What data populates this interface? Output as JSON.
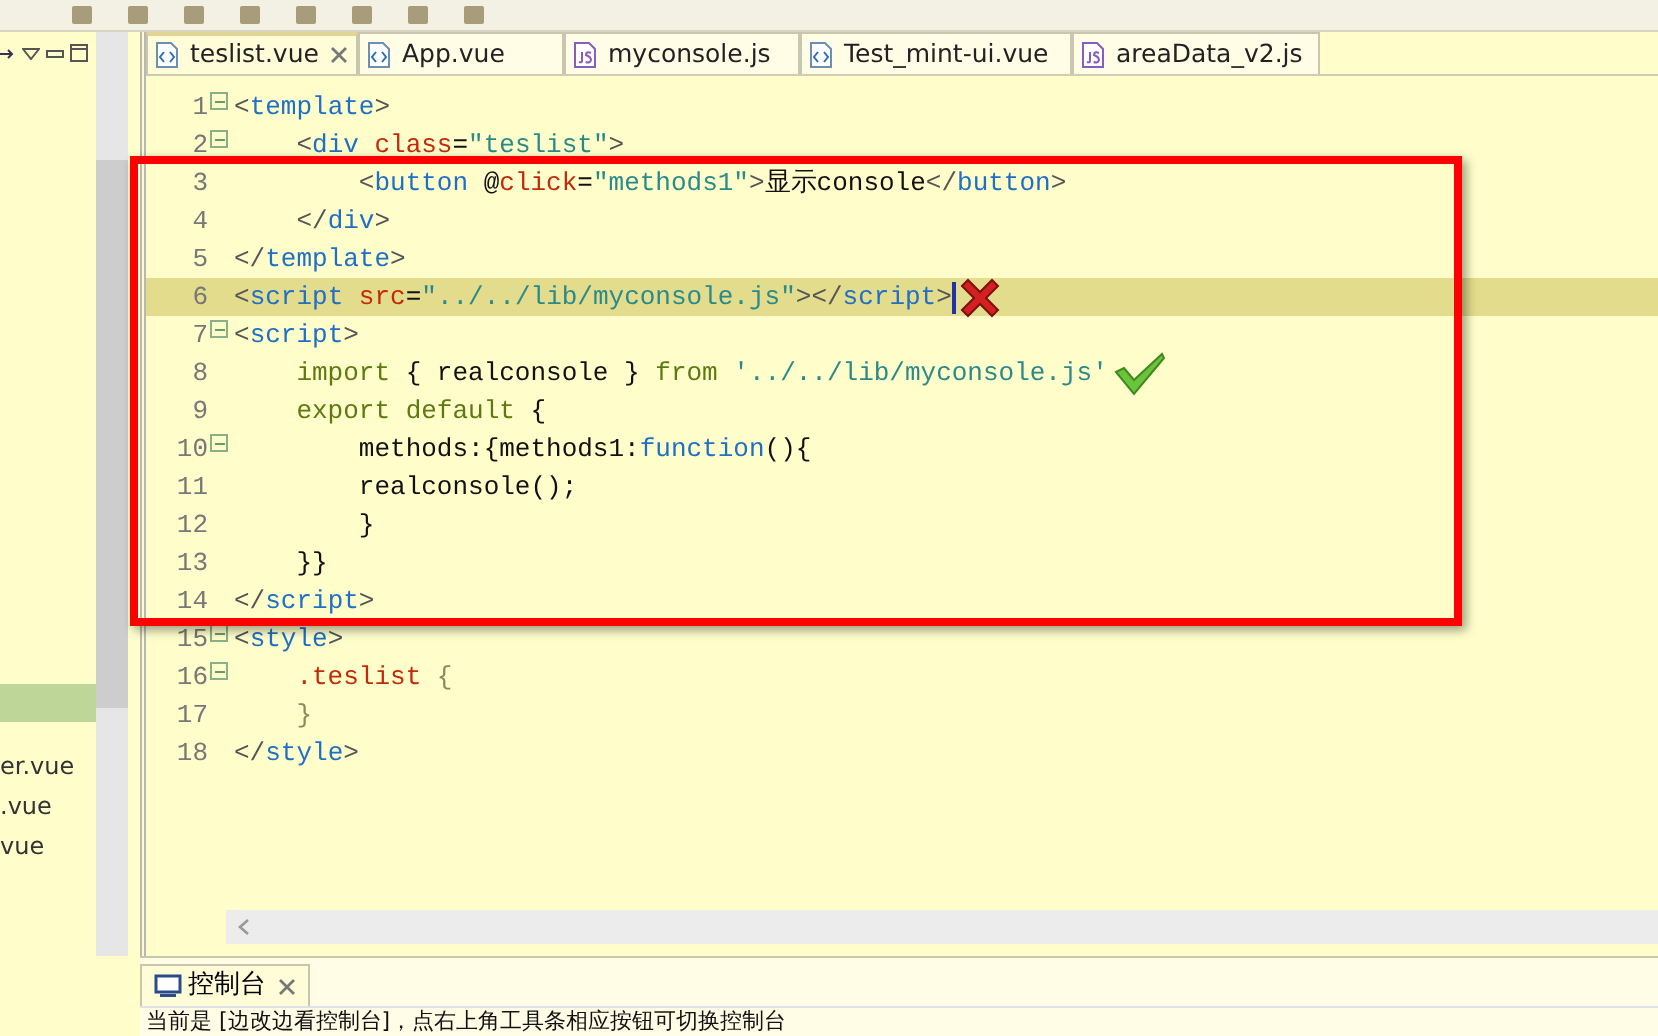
{
  "sidebar": {
    "items": [
      {
        "label": "er.vue"
      },
      {
        "label": ".vue"
      },
      {
        "label": "vue"
      }
    ]
  },
  "tabs": [
    {
      "label": "teslist.vue",
      "kind": "vue",
      "selected": true
    },
    {
      "label": "App.vue",
      "kind": "vue",
      "selected": false
    },
    {
      "label": "myconsole.js",
      "kind": "js",
      "selected": false
    },
    {
      "label": "Test_mint-ui.vue",
      "kind": "vue",
      "selected": false
    },
    {
      "label": "areaData_v2.js",
      "kind": "js",
      "selected": false
    }
  ],
  "editor": {
    "lines": [
      {
        "number": "1",
        "foldable": true,
        "highlighted": false,
        "tokens": [
          {
            "kind": "punct",
            "text": "<"
          },
          {
            "kind": "tag",
            "text": "template"
          },
          {
            "kind": "punct",
            "text": ">"
          }
        ]
      },
      {
        "number": "2",
        "foldable": true,
        "highlighted": false,
        "tokens": [
          {
            "kind": "punct",
            "text": "    <"
          },
          {
            "kind": "tag",
            "text": "div"
          },
          {
            "kind": "attr",
            "text": " class"
          },
          {
            "kind": "text",
            "text": "="
          },
          {
            "kind": "str",
            "text": "\"teslist\""
          },
          {
            "kind": "punct",
            "text": ">"
          }
        ]
      },
      {
        "number": "3",
        "foldable": false,
        "highlighted": false,
        "tokens": [
          {
            "kind": "punct",
            "text": "        <"
          },
          {
            "kind": "tag",
            "text": "button"
          },
          {
            "kind": "text",
            "text": " @"
          },
          {
            "kind": "attr",
            "text": "click"
          },
          {
            "kind": "text",
            "text": "="
          },
          {
            "kind": "str",
            "text": "\"methods1\""
          },
          {
            "kind": "punct",
            "text": ">"
          },
          {
            "kind": "text",
            "text": "显示console"
          },
          {
            "kind": "punct",
            "text": "</"
          },
          {
            "kind": "tag",
            "text": "button"
          },
          {
            "kind": "punct",
            "text": ">"
          }
        ]
      },
      {
        "number": "4",
        "foldable": false,
        "highlighted": false,
        "tokens": [
          {
            "kind": "punct",
            "text": "    </"
          },
          {
            "kind": "tag",
            "text": "div"
          },
          {
            "kind": "punct",
            "text": ">"
          }
        ]
      },
      {
        "number": "5",
        "foldable": false,
        "highlighted": false,
        "tokens": [
          {
            "kind": "punct",
            "text": "</"
          },
          {
            "kind": "tag",
            "text": "template"
          },
          {
            "kind": "punct",
            "text": ">"
          }
        ]
      },
      {
        "number": "6",
        "foldable": false,
        "highlighted": true,
        "cursor": true,
        "kind": "error",
        "tokens": [
          {
            "kind": "punct",
            "text": "<"
          },
          {
            "kind": "tag",
            "text": "script"
          },
          {
            "kind": "attr",
            "text": " src"
          },
          {
            "kind": "text",
            "text": "="
          },
          {
            "kind": "str",
            "text": "\"../../lib/myconsole.js\""
          },
          {
            "kind": "punct",
            "text": "></"
          },
          {
            "kind": "tag",
            "text": "script"
          },
          {
            "kind": "punct",
            "text": ">"
          }
        ]
      },
      {
        "number": "7",
        "foldable": true,
        "highlighted": false,
        "tokens": [
          {
            "kind": "punct",
            "text": "<"
          },
          {
            "kind": "tag",
            "text": "script"
          },
          {
            "kind": "punct",
            "text": ">"
          }
        ]
      },
      {
        "number": "8",
        "foldable": false,
        "highlighted": false,
        "kind": "ok",
        "tokens": [
          {
            "kind": "kw",
            "text": "    import"
          },
          {
            "kind": "text",
            "text": " { realconsole } "
          },
          {
            "kind": "kw",
            "text": "from"
          },
          {
            "kind": "str",
            "text": " '../../lib/myconsole.js'"
          }
        ]
      },
      {
        "number": "9",
        "foldable": false,
        "highlighted": false,
        "tokens": [
          {
            "kind": "kw",
            "text": "    export default"
          },
          {
            "kind": "text",
            "text": " {"
          }
        ]
      },
      {
        "number": "10",
        "foldable": true,
        "highlighted": false,
        "tokens": [
          {
            "kind": "text",
            "text": "        methods:{methods1:"
          },
          {
            "kind": "tag",
            "text": "function"
          },
          {
            "kind": "text",
            "text": "(){"
          }
        ]
      },
      {
        "number": "11",
        "foldable": false,
        "highlighted": false,
        "tokens": [
          {
            "kind": "text",
            "text": "        realconsole();"
          }
        ]
      },
      {
        "number": "12",
        "foldable": false,
        "highlighted": false,
        "tokens": [
          {
            "kind": "text",
            "text": "        }"
          }
        ]
      },
      {
        "number": "13",
        "foldable": false,
        "highlighted": false,
        "tokens": [
          {
            "kind": "text",
            "text": "    }}"
          }
        ]
      },
      {
        "number": "14",
        "foldable": false,
        "highlighted": false,
        "tokens": [
          {
            "kind": "punct",
            "text": "</"
          },
          {
            "kind": "tag",
            "text": "script"
          },
          {
            "kind": "punct",
            "text": ">"
          }
        ]
      },
      {
        "number": "15",
        "foldable": true,
        "highlighted": false,
        "tokens": [
          {
            "kind": "punct",
            "text": "<"
          },
          {
            "kind": "tag",
            "text": "style"
          },
          {
            "kind": "punct",
            "text": ">"
          }
        ]
      },
      {
        "number": "16",
        "foldable": true,
        "highlighted": false,
        "tokens": [
          {
            "kind": "sel",
            "text": "    .teslist"
          },
          {
            "kind": "brace",
            "text": " {"
          }
        ]
      },
      {
        "number": "17",
        "foldable": false,
        "highlighted": false,
        "tokens": [
          {
            "kind": "brace",
            "text": "    }"
          }
        ]
      },
      {
        "number": "18",
        "foldable": false,
        "highlighted": false,
        "tokens": [
          {
            "kind": "punct",
            "text": "</"
          },
          {
            "kind": "tag",
            "text": "style"
          },
          {
            "kind": "punct",
            "text": ">"
          }
        ]
      }
    ]
  },
  "console": {
    "tab": "控制台",
    "message": "当前是 [边改边看控制台]，点右上角工具条相应按钮可切换控制台"
  }
}
